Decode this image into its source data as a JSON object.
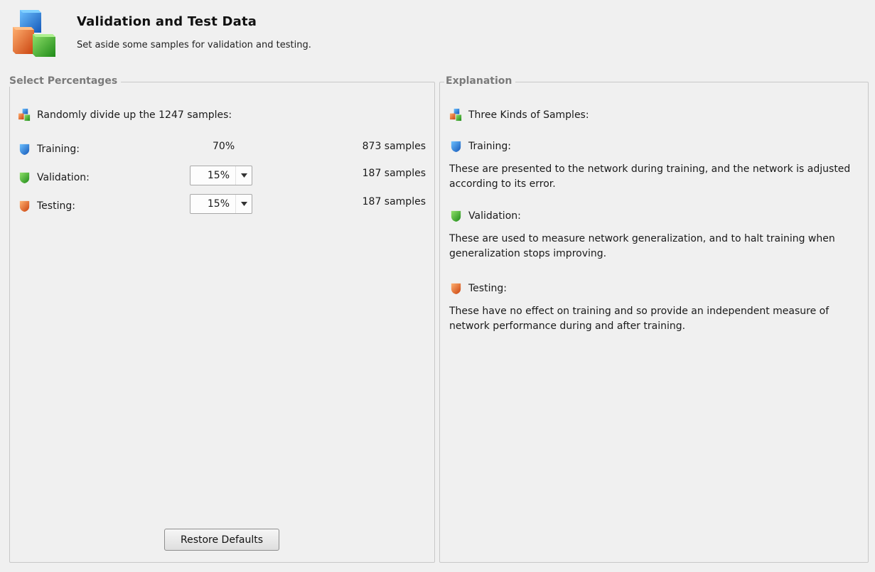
{
  "header": {
    "title": "Validation and Test Data",
    "subtitle": "Set aside some samples for validation and testing."
  },
  "left_panel": {
    "legend": "Select Percentages",
    "intro": "Randomly divide up the 1247 samples:",
    "rows": [
      {
        "label": "Training:",
        "percent": "70%",
        "samples": "873 samples"
      },
      {
        "label": "Validation:",
        "percent": "15%",
        "samples": "187 samples"
      },
      {
        "label": "Testing:",
        "percent": "15%",
        "samples": "187 samples"
      }
    ],
    "restore_button": "Restore Defaults"
  },
  "right_panel": {
    "legend": "Explanation",
    "heading": "Three Kinds of Samples:",
    "sections": [
      {
        "title": "Training:",
        "text": "These are presented to the network during training, and the network is adjusted according to its error."
      },
      {
        "title": "Validation:",
        "text": "These are used to measure network generalization, and to halt training when generalization stops improving."
      },
      {
        "title": "Testing:",
        "text": "These have no effect on training and so provide an independent measure of network performance during and after training."
      }
    ]
  },
  "icons": {
    "header": "cubes-icon",
    "training": "blue-shield-icon",
    "validation": "green-shield-icon",
    "testing": "orange-shield-icon"
  },
  "colors": {
    "background": "#f0f0f0",
    "training_blue": "#2f7fd8",
    "validation_green": "#3caa2a",
    "testing_orange": "#e36a1e"
  }
}
